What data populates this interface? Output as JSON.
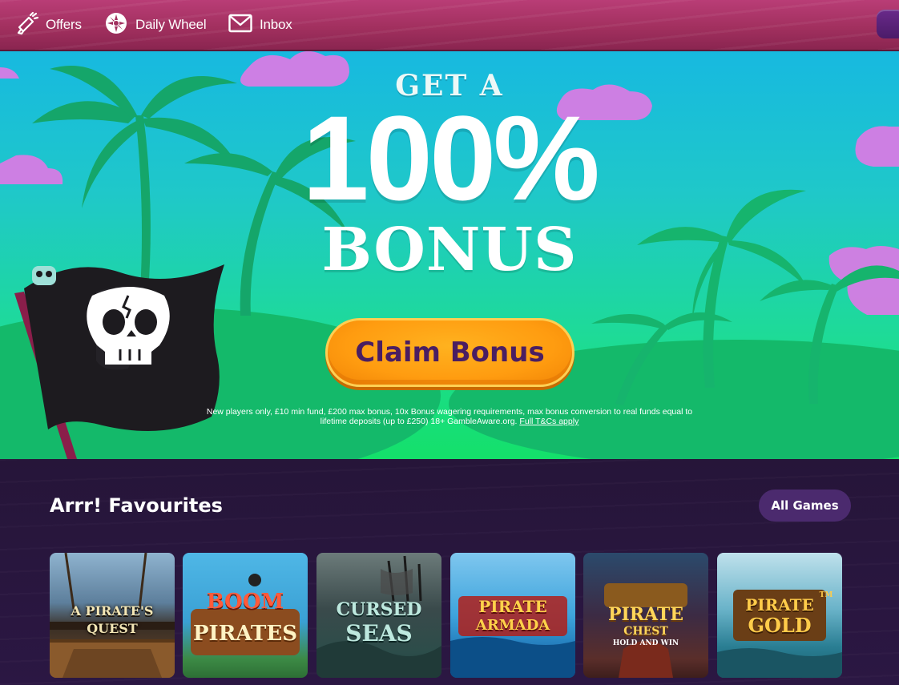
{
  "nav": {
    "offers_label": "Offers",
    "wheel_label": "Daily Wheel",
    "inbox_label": "Inbox"
  },
  "hero": {
    "headline_top": "GET A",
    "headline_percent": "100%",
    "headline_bottom": "BONUS",
    "cta_label": "Claim Bonus",
    "terms_text": "New players only, £10 min fund, £200 max bonus, 10x Bonus wagering requirements, max bonus conversion to real funds equal to lifetime deposits (up to £250) 18+ GambleAware.org.",
    "terms_link": "Full T&Cs apply"
  },
  "favourites": {
    "title": "Arrr! Favourites",
    "all_games_label": "All Games",
    "games": [
      {
        "title": "A PIRATE'S QUEST",
        "subtitle": ""
      },
      {
        "title": "BOOM",
        "subtitle": "PIRATES"
      },
      {
        "title": "CURSED",
        "subtitle": "SEAS"
      },
      {
        "title": "PIRATE",
        "subtitle": "ARMADA"
      },
      {
        "title": "PIRATE",
        "subtitle": "CHEST",
        "tagline": "HOLD AND WIN"
      },
      {
        "title": "PIRATE",
        "subtitle": "GOLD",
        "mark": "TM"
      }
    ]
  },
  "colors": {
    "nav_bg": "#a2305f",
    "hero_top": "#17b9e0",
    "hero_bottom": "#14e06a",
    "cta_orange": "#ff9c10",
    "cta_text": "#4a1e62",
    "section_bg": "#261539",
    "pill_bg": "#4b2a6e"
  },
  "icons": [
    "offers-megaphone-icon",
    "daily-wheel-icon",
    "inbox-envelope-icon",
    "skull-flag-icon"
  ]
}
